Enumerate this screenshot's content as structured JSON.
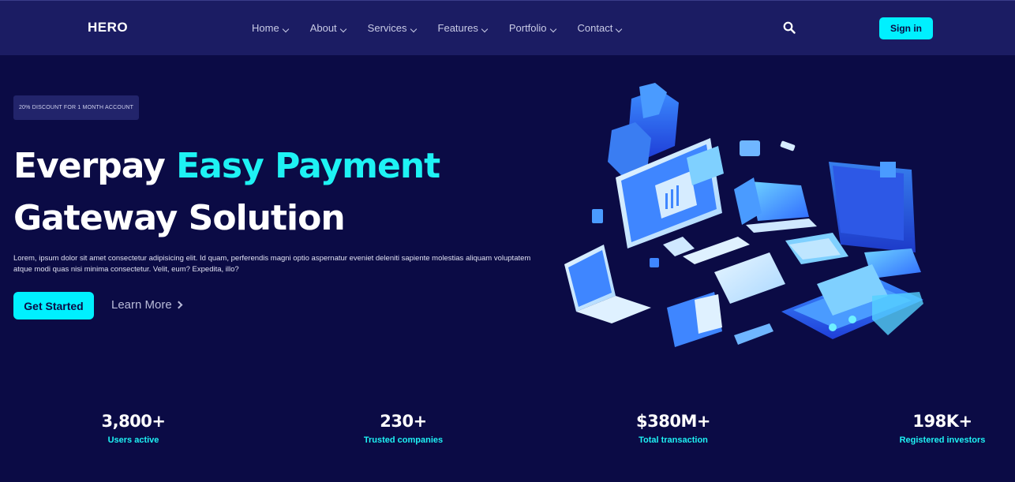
{
  "nav": {
    "logo": "HERO",
    "items": [
      {
        "label": "Home"
      },
      {
        "label": "About"
      },
      {
        "label": "Services"
      },
      {
        "label": "Features"
      },
      {
        "label": "Portfolio"
      },
      {
        "label": "Contact"
      }
    ],
    "search_icon": "search-icon",
    "signin_label": "Sign in"
  },
  "hero": {
    "badge": "20% DISCOUNT FOR 1 MONTH ACCOUNT",
    "headline_part1": "Everpay ",
    "headline_accent": "Easy Payment",
    "headline_part2": "Gateway Solution",
    "description": "Lorem, ipsum dolor sit amet consectetur adipisicing elit. Id quam, perferendis magni optio aspernatur eveniet deleniti sapiente molestias aliquam voluptatem atque modi quas nisi minima consectetur. Velit, eum? Expedita, illo?",
    "cta_primary": "Get Started",
    "cta_secondary": "Learn More",
    "illustration_icon": "isometric-payment-devices-illustration"
  },
  "stats": [
    {
      "value": "3,800+",
      "label": "Users active"
    },
    {
      "value": "230+",
      "label": "Trusted companies"
    },
    {
      "value": "$380M+",
      "label": "Total transaction"
    },
    {
      "value": "198K+",
      "label": "Registered investors"
    }
  ],
  "colors": {
    "background": "#0b0b45",
    "navbar": "#1b1c63",
    "accent": "#00f0ff",
    "text": "#ffffff"
  }
}
